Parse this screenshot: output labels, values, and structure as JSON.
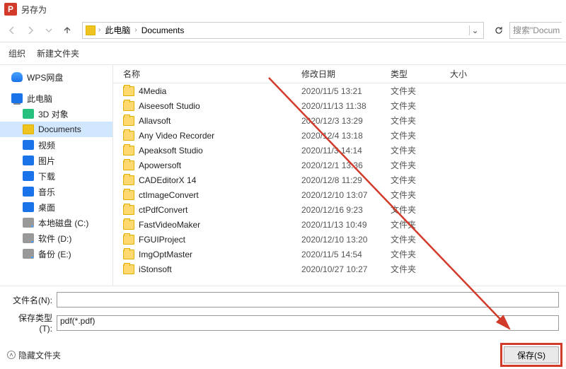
{
  "window": {
    "title": "另存为"
  },
  "nav": {
    "breadcrumb": {
      "root": "此电脑",
      "folder": "Documents"
    },
    "search_placeholder": "搜索\"Docum"
  },
  "toolbar": {
    "organize": "组织",
    "newfolder": "新建文件夹"
  },
  "sidebar": {
    "wps": "WPS网盘",
    "pc": "此电脑",
    "obj": "3D 对象",
    "docs": "Documents",
    "video": "视频",
    "pics": "图片",
    "dl": "下载",
    "music": "音乐",
    "desktop": "桌面",
    "ldisk": "本地磁盘 (C:)",
    "soft": "软件 (D:)",
    "bak": "备份 (E:)"
  },
  "columns": {
    "name": "名称",
    "date": "修改日期",
    "type": "类型",
    "size": "大小"
  },
  "type_folder": "文件夹",
  "files": [
    {
      "name": "4Media",
      "date": "2020/11/5 13:21"
    },
    {
      "name": "Aiseesoft Studio",
      "date": "2020/11/13 11:38"
    },
    {
      "name": "Allavsoft",
      "date": "2020/12/3 13:29"
    },
    {
      "name": "Any Video Recorder",
      "date": "2020/12/4 13:18"
    },
    {
      "name": "Apeaksoft Studio",
      "date": "2020/11/3 14:14"
    },
    {
      "name": "Apowersoft",
      "date": "2020/12/1 13:36"
    },
    {
      "name": "CADEditorX 14",
      "date": "2020/12/8 11:29"
    },
    {
      "name": "ctImageConvert",
      "date": "2020/12/10 13:07"
    },
    {
      "name": "ctPdfConvert",
      "date": "2020/12/16 9:23"
    },
    {
      "name": "FastVideoMaker",
      "date": "2020/11/13 10:49"
    },
    {
      "name": "FGUIProject",
      "date": "2020/12/10 13:20"
    },
    {
      "name": "ImgOptMaster",
      "date": "2020/11/5 14:54"
    },
    {
      "name": "iStonsoft",
      "date": "2020/10/27 10:27"
    }
  ],
  "fields": {
    "filename_label": "文件名(N):",
    "filename_value": "",
    "filetype_label": "保存类型(T):",
    "filetype_value": "pdf(*.pdf)"
  },
  "footer": {
    "hide_folders": "隐藏文件夹",
    "save": "保存(S)"
  }
}
